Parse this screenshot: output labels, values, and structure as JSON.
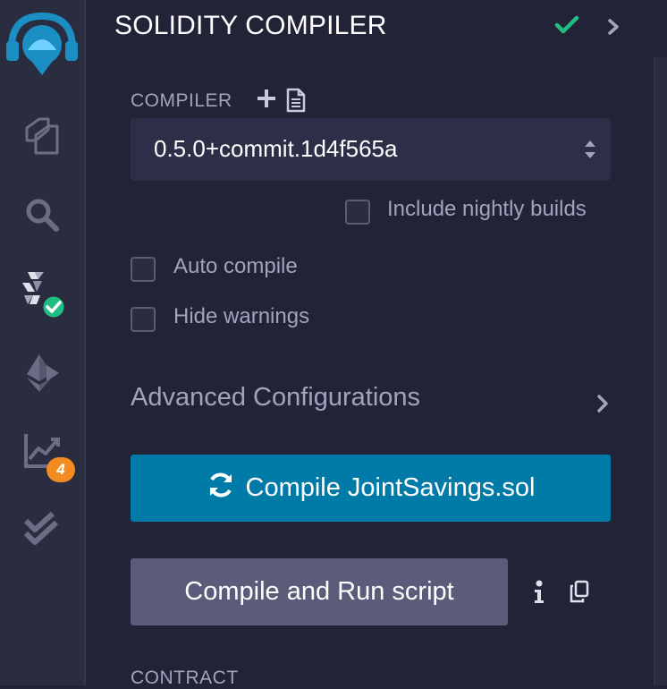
{
  "colors": {
    "background": "#222336",
    "icon_bar": "#2a2c3f",
    "accent_blue": "#007aa6",
    "secondary_button": "#5a5c7a",
    "success_green": "#1fbf83",
    "badge_orange": "#f28b22",
    "label_text": "#a2a3bd"
  },
  "icon_bar": {
    "items": [
      {
        "icon": "remix-logo-icon"
      },
      {
        "icon": "file-explorer-icon"
      },
      {
        "icon": "search-icon"
      },
      {
        "icon": "solidity-compiler-icon",
        "status": "success-check"
      },
      {
        "icon": "deploy-run-icon"
      },
      {
        "icon": "analytics-icon",
        "badge": "4"
      },
      {
        "icon": "double-check-icon"
      }
    ]
  },
  "header": {
    "title": "SOLIDITY COMPILER",
    "status_icon": "check-icon",
    "collapse_icon": "chevron-right-icon"
  },
  "compiler": {
    "label": "COMPILER",
    "add_icon": "plus-icon",
    "license_icon": "file-icon",
    "selected_version": "0.5.0+commit.1d4f565a",
    "include_nightly_label": "Include nightly builds"
  },
  "options": {
    "auto_compile_label": "Auto compile",
    "hide_warnings_label": "Hide warnings"
  },
  "advanced": {
    "label": "Advanced Configurations"
  },
  "actions": {
    "compile_label": "Compile JointSavings.sol",
    "compile_icon": "refresh-icon",
    "run_script_label": "Compile and Run script",
    "info_icon": "info-icon",
    "copy_icon": "copy-icon"
  },
  "contract": {
    "label": "CONTRACT"
  }
}
